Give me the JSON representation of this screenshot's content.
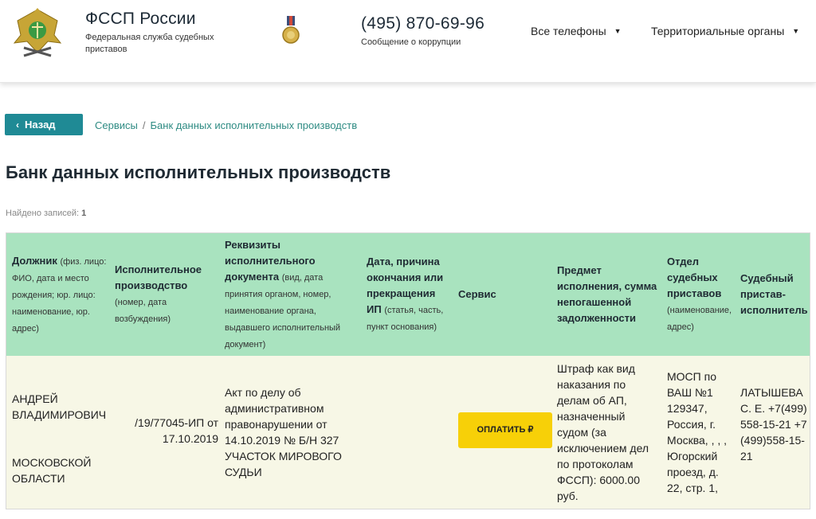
{
  "header": {
    "brand_title": "ФССП России",
    "brand_subtitle": "Федеральная служба судебных приставов",
    "phone": "(495) 870-69-96",
    "phone_sub": "Сообщение о коррупции",
    "nav": [
      {
        "label": "Все телефоны"
      },
      {
        "label": "Территориальные органы"
      }
    ]
  },
  "breadcrumb": {
    "back_label": "Назад",
    "items": [
      "Сервисы",
      "Банк данных исполнительных производств"
    ],
    "separator": "/"
  },
  "page": {
    "title": "Банк данных исполнительных производств",
    "found_label": "Найдено записей:",
    "found_count": "1"
  },
  "table": {
    "headers": [
      {
        "title": "Должник",
        "note": "(физ. лицо: ФИО, дата и место рождения; юр. лицо: наименование, юр. адрес)"
      },
      {
        "title": "Исполнительное производство",
        "note": "(номер, дата возбуждения)"
      },
      {
        "title": "Реквизиты исполнительного документа",
        "note": "(вид, дата принятия органом, номер, наименование органа, выдавшего исполнительный документ)"
      },
      {
        "title": "Дата, причина окончания или прекращения ИП",
        "note": "(статья, часть, пункт основания)"
      },
      {
        "title": "Сервис",
        "note": ""
      },
      {
        "title": "Предмет исполнения, сумма непогашенной задолженности",
        "note": ""
      },
      {
        "title": "Отдел судебных приставов",
        "note": "(наименование, адрес)"
      },
      {
        "title": "Судебный пристав-исполнитель",
        "note": ""
      }
    ],
    "row": {
      "debtor_name": "АНДРЕЙ ВЛАДИМИРОВИЧ",
      "debtor_place": "МОСКОВСКОЙ ОБЛАСТИ",
      "proceeding": "/19/77045-ИП от 17.10.2019",
      "document": "Акт по делу об административном правонарушении от 14.10.2019 № Б/Н 327 УЧАСТОК МИРОВОГО СУДЬИ",
      "end_reason": "",
      "pay_label": "ОПЛАТИТЬ ₽",
      "subject": "Штраф как вид наказания по делам об АП, назначенный судом (за исключением дел по протоколам ФССП): 6000.00 руб.",
      "department": "МОСП по ВАШ №1 129347, Россия, г. Москва, , , , Югорский проезд, д. 22, стр. 1,",
      "bailiff": "ЛАТЫШЕВА С. Е. +7(499)558-15-21 +7(499)558-15-21"
    }
  },
  "colors": {
    "header_row": "#a9e3bf",
    "body_row": "#f7f7e6",
    "accent_teal": "#1f8a95",
    "pay_yellow": "#f7d008",
    "link_green": "#2e8b83"
  },
  "icons": [
    "emblem-icon",
    "medal-icon",
    "chevron-left-icon",
    "caret-down-icon"
  ]
}
